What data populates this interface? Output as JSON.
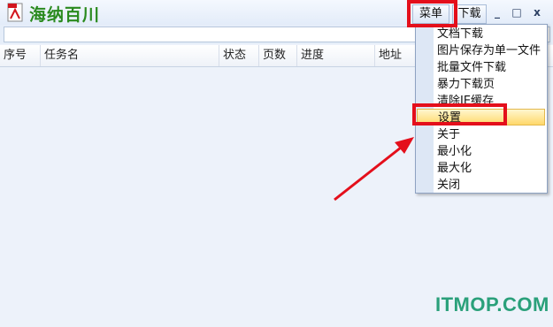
{
  "window": {
    "title": "海纳百川",
    "minimize_glyph": "_",
    "maximize_glyph": "□",
    "close_glyph": "x"
  },
  "menubar": {
    "menu_label": "菜单",
    "download_label": "下载"
  },
  "table": {
    "columns": [
      "序号",
      "任务名",
      "状态",
      "页数",
      "进度",
      "地址"
    ]
  },
  "dropdown_menu": {
    "items": [
      "文档下载",
      "图片保存为单一文件",
      "批量文件下载",
      "暴力下载页",
      "清除IE缓存",
      "设置",
      "关于",
      "最小化",
      "最大化",
      "关闭"
    ],
    "highlighted": "设置"
  },
  "annotation": {
    "color": "#e40f1b"
  },
  "watermark": "ITMOP.COM"
}
